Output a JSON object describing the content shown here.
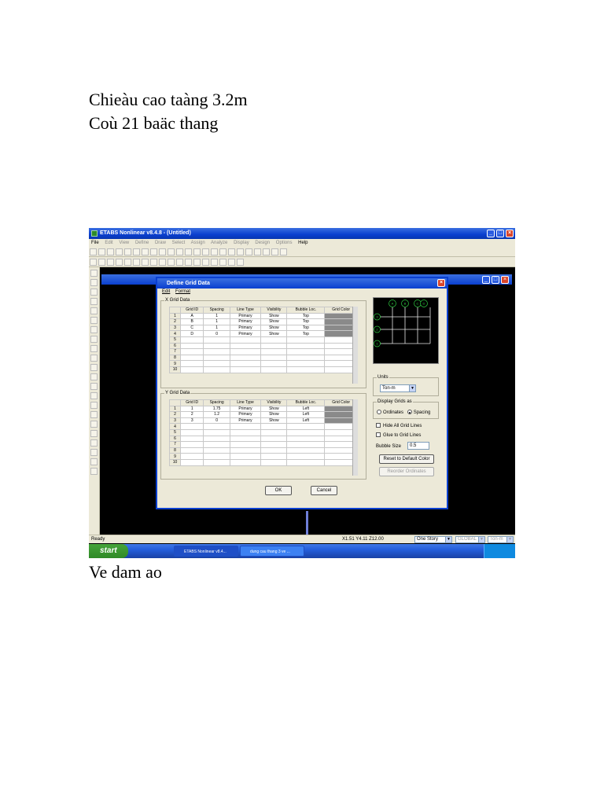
{
  "document": {
    "line1": "Chieàu cao taàng 3.2m",
    "line2": "Coù 21 baäc thang",
    "caption": "Ve dam ao"
  },
  "app": {
    "title": "ETABS Nonlinear v8.4.8 - (Untitled)",
    "menu": [
      "File",
      "Edit",
      "View",
      "Define",
      "Draw",
      "Select",
      "Assign",
      "Analyze",
      "Display",
      "Design",
      "Options",
      "Help"
    ],
    "status_left": "Ready",
    "status_coords": "X1.51  Y4.11  Z12.00",
    "story_select": "One Story",
    "coord_select": "GLOBAL",
    "units_select": "Ton-m"
  },
  "taskbar": {
    "start_label": "start",
    "task1": "ETABS Nonlinear v8.4...",
    "task2": "dung cau thang 3 ve ..."
  },
  "dialog": {
    "title": "Define Grid Data",
    "menu": [
      "Edit",
      "Format"
    ],
    "x_group_label": "X Grid Data",
    "y_group_label": "Y Grid Data",
    "columns": [
      "Grid ID",
      "Spacing",
      "Line Type",
      "Visibility",
      "Bubble Loc.",
      "Grid Color"
    ],
    "x_rows": [
      [
        "1",
        "A",
        "1",
        "Primary",
        "Show",
        "Top"
      ],
      [
        "2",
        "B",
        "1",
        "Primary",
        "Show",
        "Top"
      ],
      [
        "3",
        "C",
        "1",
        "Primary",
        "Show",
        "Top"
      ],
      [
        "4",
        "D",
        "0",
        "Primary",
        "Show",
        "Top"
      ],
      [
        "5",
        "",
        "",
        "",
        "",
        ""
      ],
      [
        "6",
        "",
        "",
        "",
        "",
        ""
      ],
      [
        "7",
        "",
        "",
        "",
        "",
        ""
      ],
      [
        "8",
        "",
        "",
        "",
        "",
        ""
      ],
      [
        "9",
        "",
        "",
        "",
        "",
        ""
      ],
      [
        "10",
        "",
        "",
        "",
        "",
        ""
      ]
    ],
    "y_rows": [
      [
        "1",
        "1",
        "1.75",
        "Primary",
        "Show",
        "Left"
      ],
      [
        "2",
        "2",
        "1.2",
        "Primary",
        "Show",
        "Left"
      ],
      [
        "3",
        "3",
        "0",
        "Primary",
        "Show",
        "Left"
      ],
      [
        "4",
        "",
        "",
        "",
        "",
        ""
      ],
      [
        "5",
        "",
        "",
        "",
        "",
        ""
      ],
      [
        "6",
        "",
        "",
        "",
        "",
        ""
      ],
      [
        "7",
        "",
        "",
        "",
        "",
        ""
      ],
      [
        "8",
        "",
        "",
        "",
        "",
        ""
      ],
      [
        "9",
        "",
        "",
        "",
        "",
        ""
      ],
      [
        "10",
        "",
        "",
        "",
        "",
        ""
      ]
    ],
    "preview_x_bubbles": [
      "A",
      "B",
      "C",
      "D"
    ],
    "preview_y_bubbles": [
      "3",
      "2",
      "1"
    ],
    "units_label": "Units",
    "units_value": "Ton-m",
    "display_label": "Display Grids as",
    "ordinates_label": "Ordinates",
    "spacing_label": "Spacing",
    "hide_label": "Hide All Grid Lines",
    "glue_label": "Glue to Grid Lines",
    "bubble_label": "Bubble Size",
    "bubble_value": "0.5",
    "reset_button": "Reset to Default Color",
    "reorder_button": "Reorder Ordinates",
    "ok_button": "OK",
    "cancel_button": "Cancel"
  }
}
